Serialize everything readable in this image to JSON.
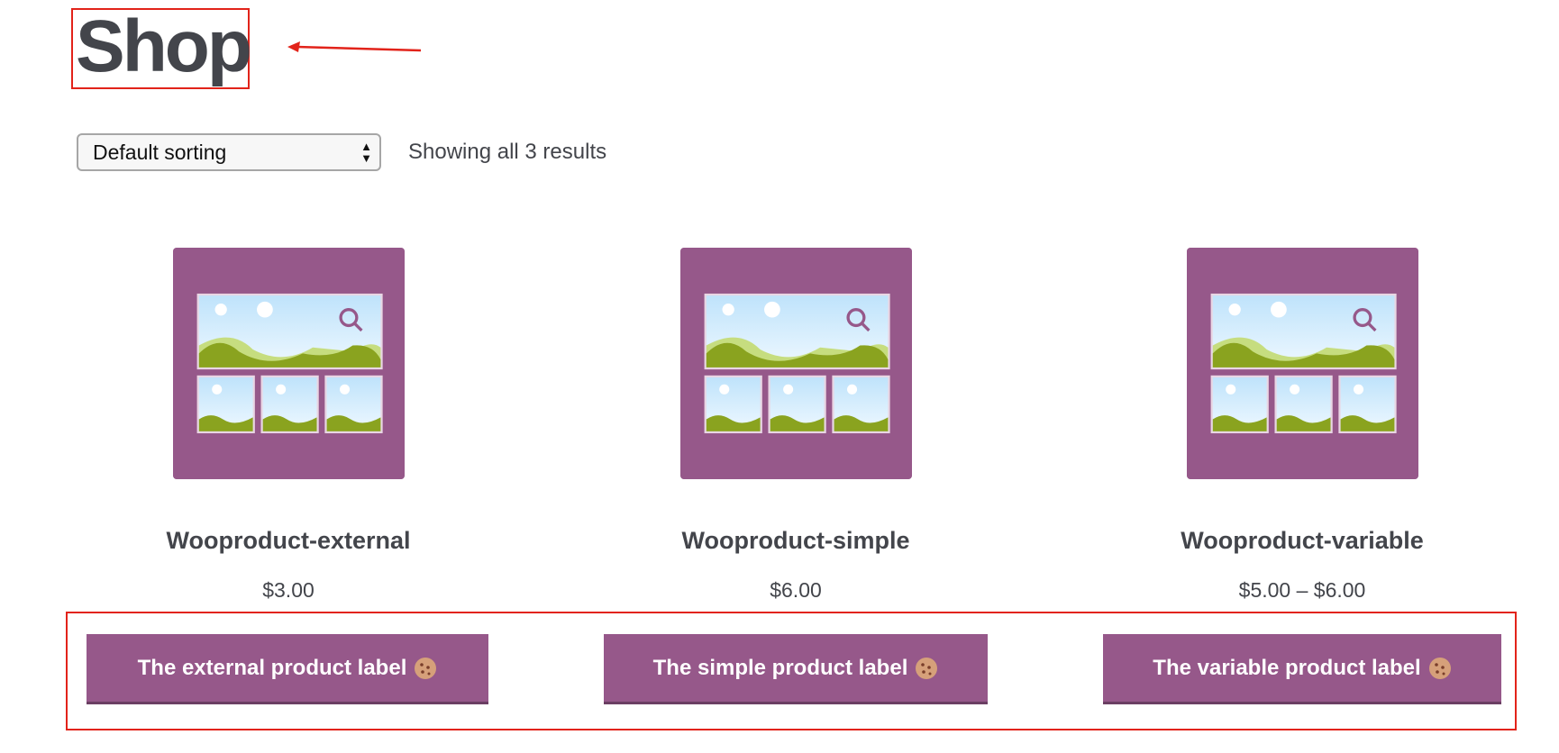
{
  "page": {
    "title": "Shop"
  },
  "toolbar": {
    "sort_selected": "Default sorting",
    "result_count": "Showing all 3 results"
  },
  "products": [
    {
      "name": "Wooproduct-external",
      "price": "$3.00",
      "label": "The external product label"
    },
    {
      "name": "Wooproduct-simple",
      "price": "$6.00",
      "label": "The simple product label"
    },
    {
      "name": "Wooproduct-variable",
      "price": "$5.00 – $6.00",
      "label": "The variable product label"
    }
  ],
  "colors": {
    "accent": "#96588a",
    "annotation": "#e2231a",
    "text": "#43454b"
  }
}
